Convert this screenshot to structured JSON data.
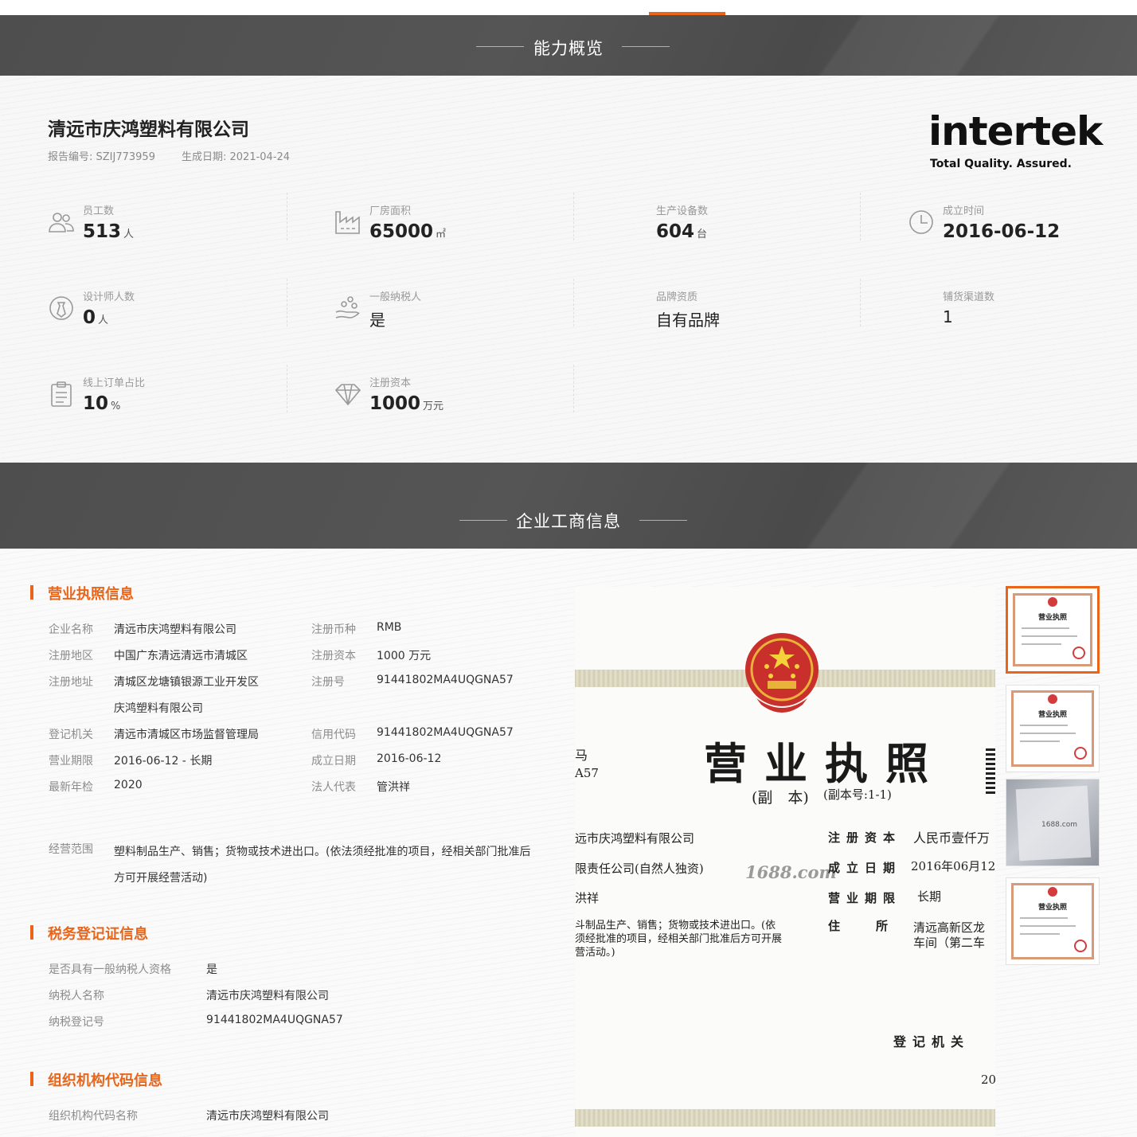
{
  "tabs_strip": {},
  "overview": {
    "section_title": "能力概览",
    "company_name": "清远市庆鸿塑料有限公司",
    "report_no": "报告编号: SZIJ773959",
    "generated_date": "生成日期: 2021-04-24",
    "logo": {
      "word": "intertek",
      "tagline": "Total Quality. Assured."
    },
    "stats": [
      {
        "label": "员工数",
        "value": "513",
        "unit": "人",
        "icon": "people-icon"
      },
      {
        "label": "厂房面积",
        "value": "65000",
        "unit": "㎡",
        "icon": "factory-icon"
      },
      {
        "label": "生产设备数",
        "value": "604",
        "unit": "台",
        "icon": ""
      },
      {
        "label": "成立时间",
        "value": "2016-06-12",
        "unit": "",
        "icon": "clock-icon"
      },
      {
        "label": "设计师人数",
        "value": "0",
        "unit": "人",
        "icon": "designer-icon"
      },
      {
        "label": "一般纳税人",
        "value": "是",
        "unit": "",
        "icon": "hand-coins-icon"
      },
      {
        "label": "品牌资质",
        "value": "自有品牌",
        "unit": "",
        "icon": ""
      },
      {
        "label": "铺货渠道数",
        "value": "1",
        "unit": "",
        "icon": ""
      },
      {
        "label": "线上订单占比",
        "value": "10",
        "unit": "%",
        "icon": "clipboard-icon"
      },
      {
        "label": "注册资本",
        "value": "1000",
        "unit": "万元",
        "icon": "diamond-icon"
      }
    ]
  },
  "business": {
    "section_title": "企业工商信息",
    "license_info": {
      "heading": "营业执照信息",
      "rows_left": [
        {
          "k": "企业名称",
          "v": "清远市庆鸿塑料有限公司"
        },
        {
          "k": "注册地区",
          "v": "中国广东清远清远市清城区"
        },
        {
          "k": "注册地址",
          "v": "清城区龙塘镇银源工业开发区"
        },
        {
          "k": "",
          "v": "庆鸿塑料有限公司"
        },
        {
          "k": "登记机关",
          "v": "清远市清城区市场监督管理局"
        },
        {
          "k": "营业期限",
          "v": "2016-06-12 - 长期"
        },
        {
          "k": "最新年检",
          "v": "2020"
        }
      ],
      "rows_right": [
        {
          "k": "注册币种",
          "v": "RMB"
        },
        {
          "k": "注册资本",
          "v": "1000 万元"
        },
        {
          "k": "注册号",
          "v": "91441802MA4UQGNA57"
        },
        {
          "k": "信用代码",
          "v": "91441802MA4UQGNA57"
        },
        {
          "k": "成立日期",
          "v": "2016-06-12"
        },
        {
          "k": "法人代表",
          "v": "管洪祥"
        }
      ],
      "scope_label": "经营范围",
      "scope_value": "塑料制品生产、销售；货物或技术进出口。(依法须经批准的项目，经相关部门批准后方可开展经营活动)"
    },
    "tax_info": {
      "heading": "税务登记证信息",
      "rows": [
        {
          "k": "是否具有一般纳税人资格",
          "v": "是"
        },
        {
          "k": "纳税人名称",
          "v": "清远市庆鸿塑料有限公司"
        },
        {
          "k": "纳税登记号",
          "v": "91441802MA4UQGNA57"
        }
      ]
    },
    "org_info": {
      "heading": "组织机构代码信息",
      "rows": [
        {
          "k": "组织机构代码名称",
          "v": "清远市庆鸿塑料有限公司"
        }
      ]
    },
    "license_image": {
      "title": "营业执照",
      "copy": "(副　本)",
      "copy_no": "(副本号:1-1)",
      "left_edge_1": "马",
      "left_edge_2": "A57",
      "company": "远市庆鸿塑料有限公司",
      "type": "限责任公司(自然人独资)",
      "person": "洪祥",
      "scope_1": "斗制品生产、销售；货物或技术进出口。(依",
      "scope_2": "须经批准的项目，经相关部门批准后方可开展",
      "scope_3": "营活动。)",
      "k_capital": "注册资本",
      "v_capital": "人民币壹仟万",
      "k_date": "成立日期",
      "v_date": "2016年06月12",
      "k_term": "营业期限",
      "v_term": "长期",
      "k_addr": "住　　　所",
      "v_addr_1": "清远高新区龙",
      "v_addr_2": "车间（第二车",
      "authority": "登记机关",
      "year": "20",
      "watermark": "1688.com",
      "thumb_title": "营业执照",
      "thumb_photo_text": "1688.com"
    }
  }
}
